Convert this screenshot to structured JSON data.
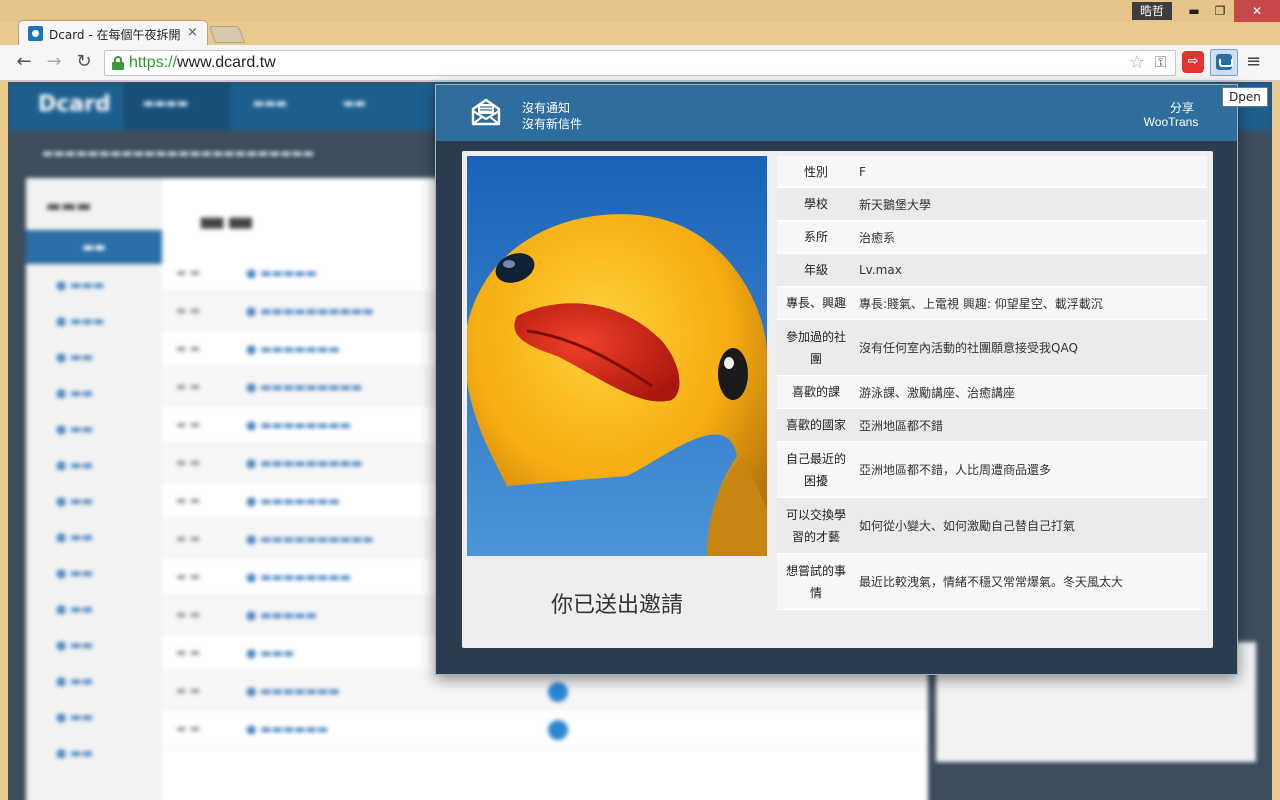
{
  "window": {
    "user": "晧哲",
    "minimize": "▬",
    "maximize": "❐",
    "close": "✕"
  },
  "tab": {
    "title": "Dcard - 在每個午夜拆開",
    "close": "×"
  },
  "toolbar": {
    "back": "←",
    "forward": "→",
    "reload": "↻",
    "url_scheme": "https://",
    "url_host": "www.dcard.tw",
    "star": "☆",
    "key": "⚿",
    "menu": "≡",
    "ext_red": "⇨",
    "tooltip": "Dpen"
  },
  "popup": {
    "notifications": "沒有通知",
    "mail": "沒有新信件",
    "share": "分享",
    "wootrans": "WooTrans",
    "invite_status": "你已送出邀請",
    "profile": [
      {
        "label": "性別",
        "value": "F"
      },
      {
        "label": "學校",
        "value": "新天鵝堡大學"
      },
      {
        "label": "系所",
        "value": "治癒系"
      },
      {
        "label": "年級",
        "value": "Lv.max"
      },
      {
        "label": "專長、興趣",
        "value": "專長:賤氣、上電視 興趣: 仰望星空、載浮載沉"
      },
      {
        "label": "參加過的社團",
        "value": "沒有任何室內活動的社團願意接受我QAQ"
      },
      {
        "label": "喜歡的課",
        "value": "游泳課、激勵講座、治癒講座"
      },
      {
        "label": "喜歡的國家",
        "value": "亞洲地區都不錯"
      },
      {
        "label": "自己最近的困擾",
        "value": "亞洲地區都不錯，人比周遭商品還多"
      },
      {
        "label": "可以交換學習的才藝",
        "value": "如何從小變大、如何激勵自己替自己打氣"
      },
      {
        "label": "想嘗試的事情",
        "value": "最近比較洩氣，情緒不穩又常常爆氣。冬天風太大"
      }
    ]
  },
  "colors": {
    "nav_blue": "#2f6e9c",
    "popup_bg": "#2b3c4e",
    "card_bg": "#eeeeee"
  }
}
